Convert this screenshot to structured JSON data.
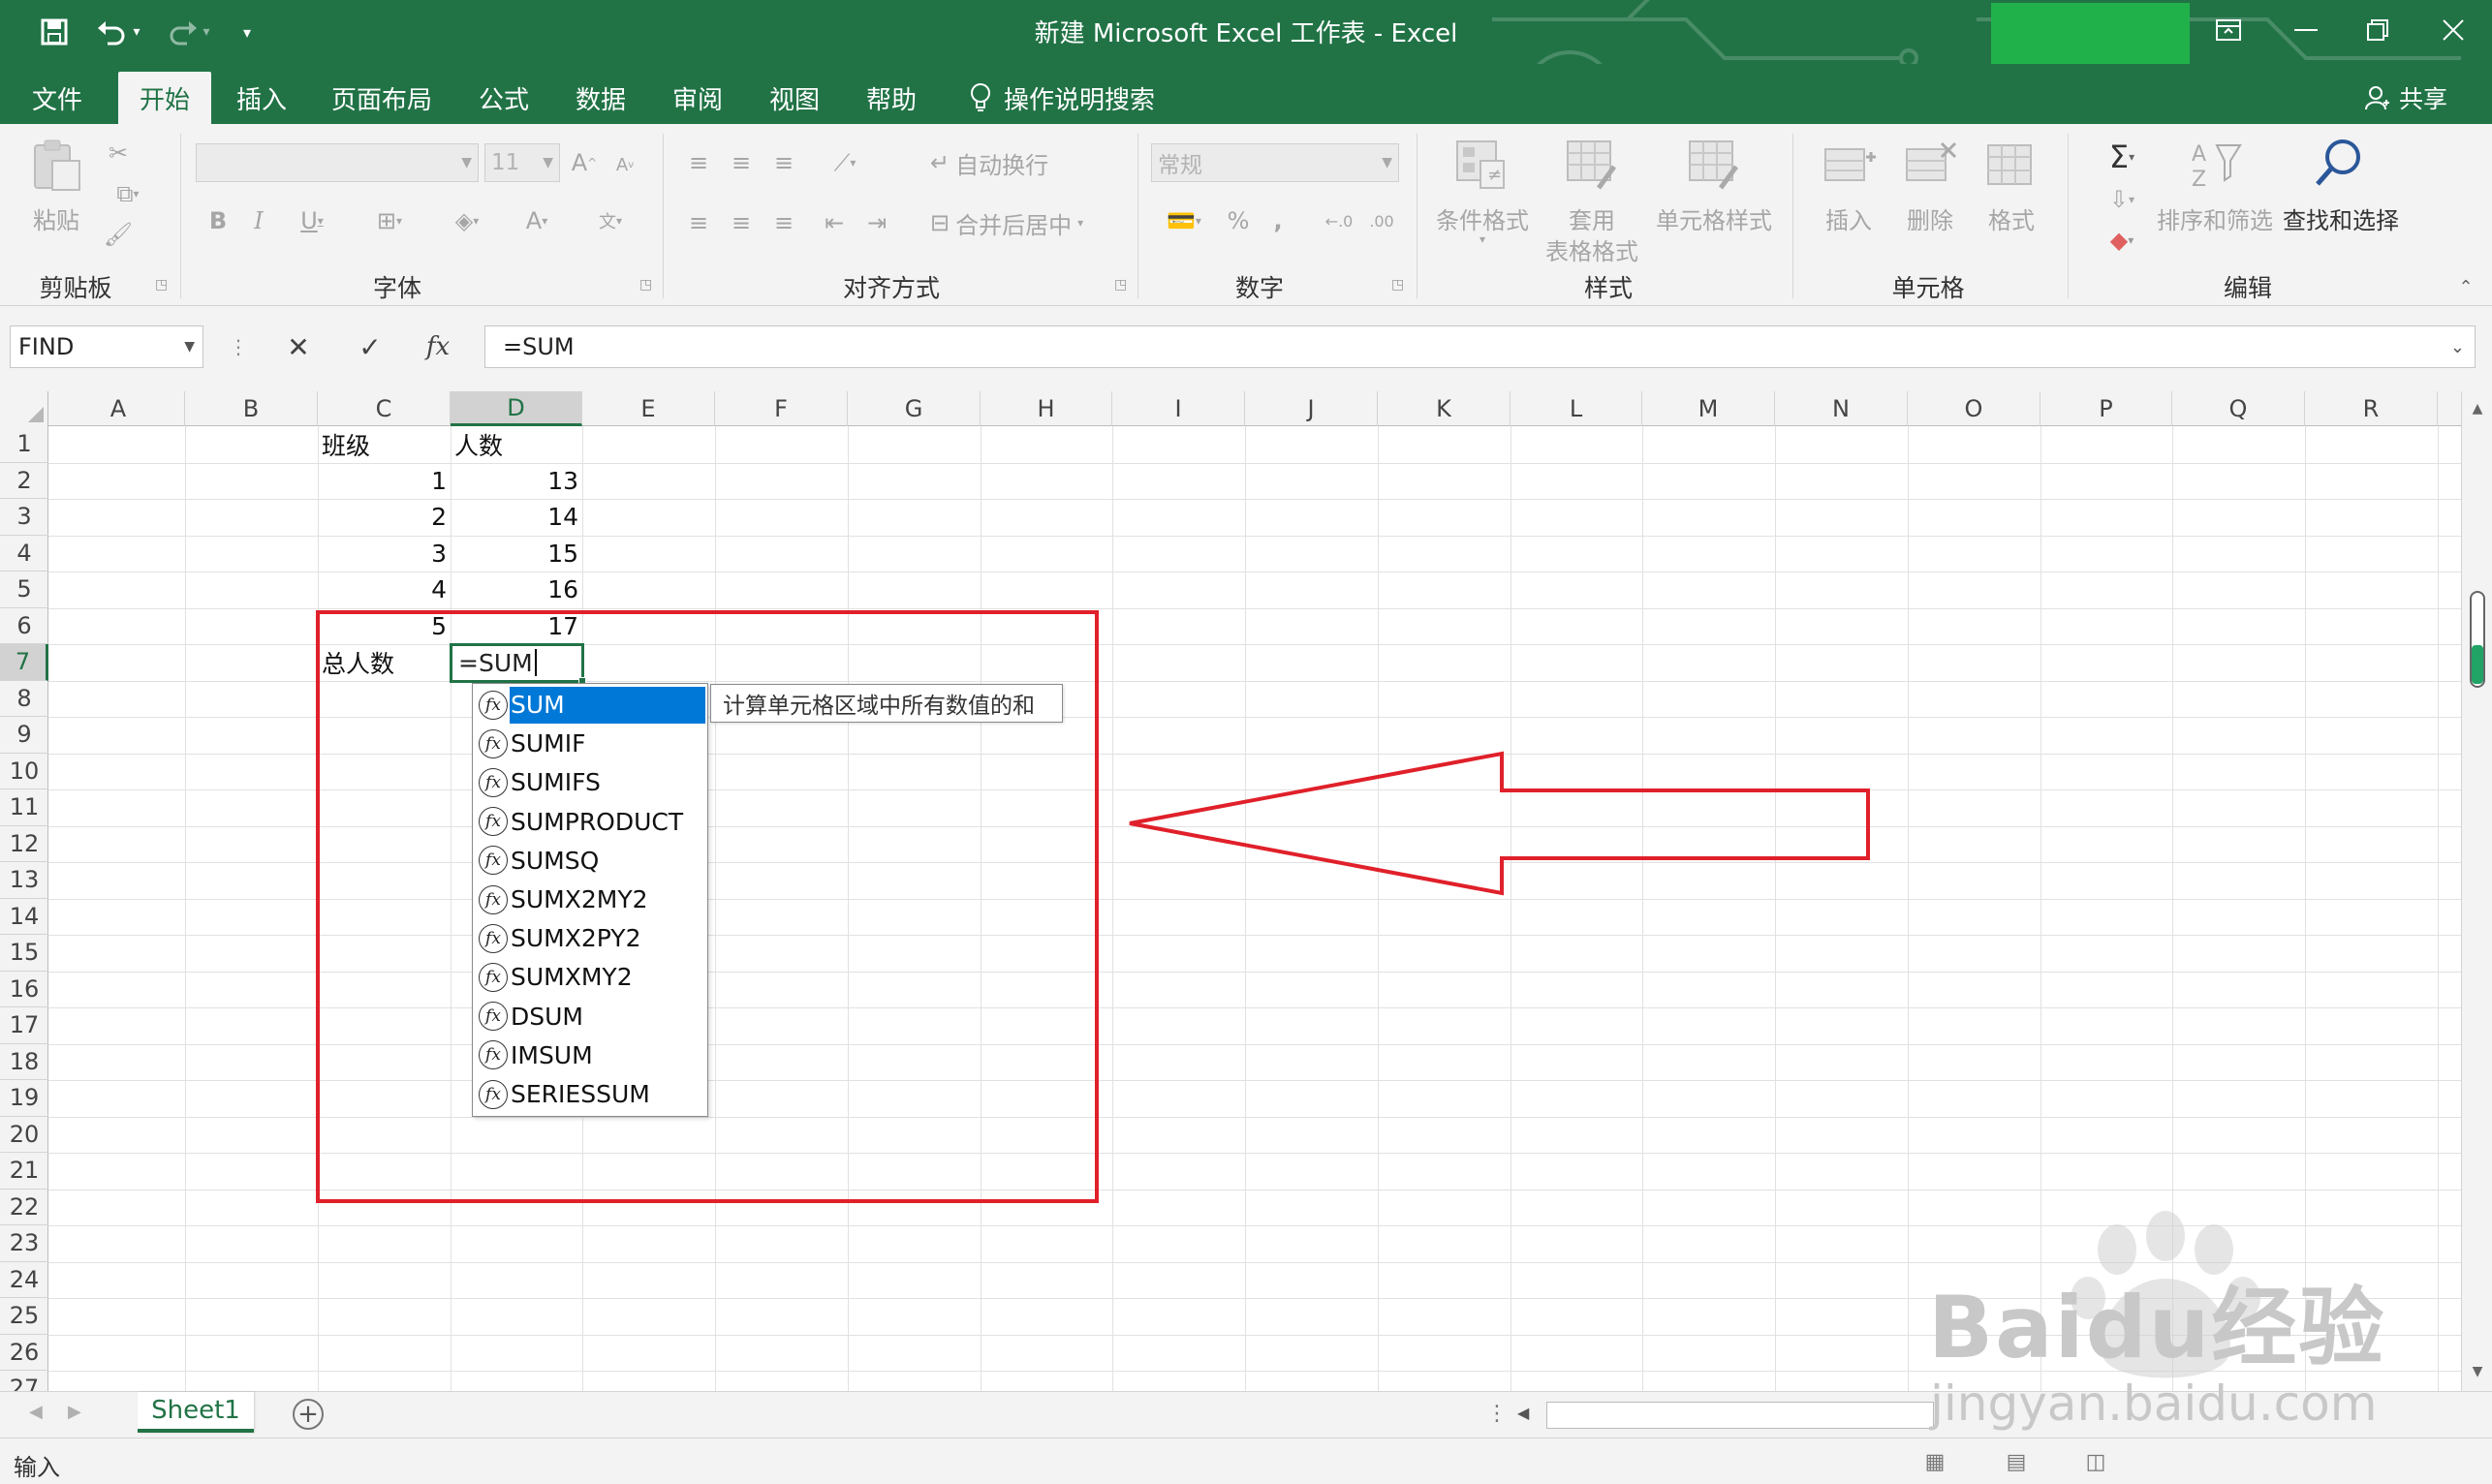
{
  "title": {
    "window_title": "新建 Microsoft Excel 工作表  -  Excel"
  },
  "tabs": [
    {
      "label": "文件"
    },
    {
      "label": "开始",
      "active": true
    },
    {
      "label": "插入"
    },
    {
      "label": "页面布局"
    },
    {
      "label": "公式"
    },
    {
      "label": "数据"
    },
    {
      "label": "审阅"
    },
    {
      "label": "视图"
    },
    {
      "label": "帮助"
    }
  ],
  "search_tab": {
    "label": "操作说明搜索"
  },
  "share": {
    "label": "共享"
  },
  "ribbon": {
    "clipboard": {
      "paste": "粘贴",
      "label": "剪贴板"
    },
    "font": {
      "font_name": "",
      "font_size": "11",
      "label": "字体"
    },
    "alignment": {
      "wrap": "自动换行",
      "merge": "合并后居中",
      "label": "对齐方式"
    },
    "number": {
      "format": "常规",
      "label": "数字"
    },
    "styles": {
      "conditional": "条件格式",
      "table_line1": "套用",
      "table_line2": "表格格式",
      "cell_style": "单元格样式",
      "label": "样式"
    },
    "cells": {
      "insert": "插入",
      "delete": "删除",
      "format": "格式",
      "label": "单元格"
    },
    "editing": {
      "sort": "排序和筛选",
      "find": "查找和选择",
      "label": "编辑"
    }
  },
  "formula_bar": {
    "name_box": "FIND",
    "formula": "=SUM"
  },
  "columns": [
    "A",
    "B",
    "C",
    "D",
    "E",
    "F",
    "G",
    "H",
    "I",
    "J",
    "K",
    "L",
    "M",
    "N",
    "O",
    "P",
    "Q",
    "R"
  ],
  "selected_column": "D",
  "selected_row": 7,
  "rows": [
    "1",
    "2",
    "3",
    "4",
    "5",
    "6",
    "7",
    "8",
    "9",
    "10",
    "11",
    "12",
    "13",
    "14",
    "15",
    "16",
    "17",
    "18",
    "19",
    "20",
    "21",
    "22",
    "23",
    "24",
    "25",
    "26",
    "27"
  ],
  "cells": {
    "C1": "班级",
    "D1": "人数",
    "C2": "1",
    "D2": "13",
    "C3": "2",
    "D3": "14",
    "C4": "3",
    "D4": "15",
    "C5": "4",
    "D5": "16",
    "C6": "5",
    "D6": "17",
    "C7": "总人数"
  },
  "active_cell": {
    "ref": "D7",
    "value": "=SUM"
  },
  "autocomplete": {
    "items": [
      "SUM",
      "SUMIF",
      "SUMIFS",
      "SUMPRODUCT",
      "SUMSQ",
      "SUMX2MY2",
      "SUMX2PY2",
      "SUMXMY2",
      "DSUM",
      "IMSUM",
      "SERIESSUM"
    ],
    "selected_index": 0,
    "tooltip": "计算单元格区域中所有数值的和"
  },
  "sheet_tabs": [
    {
      "label": "Sheet1",
      "active": true
    }
  ],
  "status": {
    "mode": "输入"
  },
  "watermark": {
    "brand": "Baidu经验",
    "url": "jingyan.baidu.com"
  },
  "colors": {
    "excel_green": "#217346",
    "annotation_red": "#e0202a",
    "selection_blue": "#0078d7"
  }
}
